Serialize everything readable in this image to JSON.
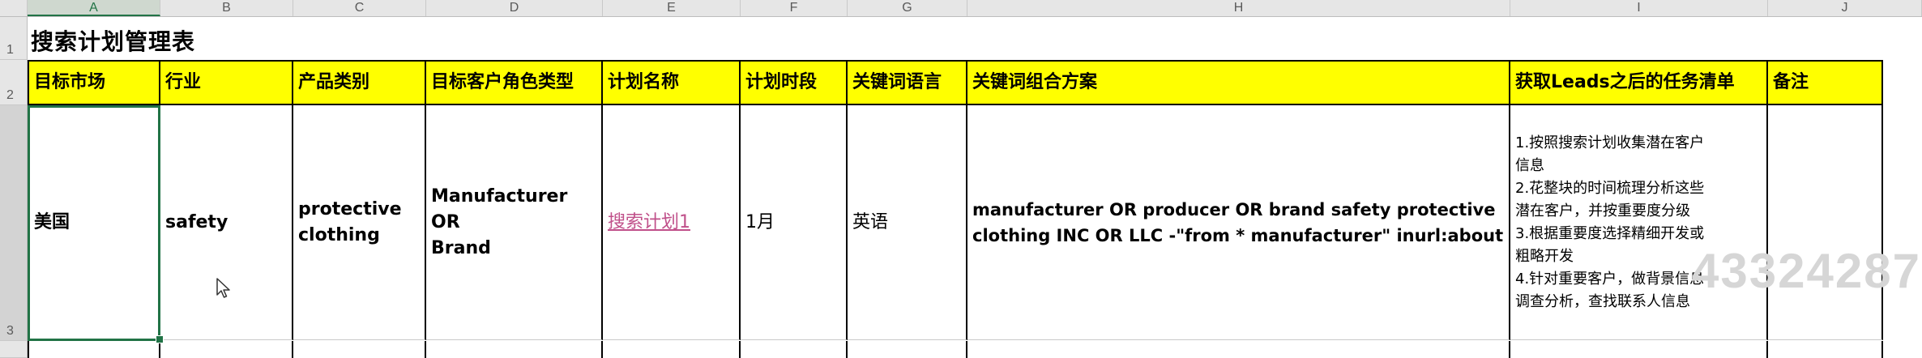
{
  "columns": [
    "A",
    "B",
    "C",
    "D",
    "E",
    "F",
    "G",
    "H",
    "I",
    "J"
  ],
  "rows": [
    "1",
    "2",
    "3"
  ],
  "sheet_title": "搜索计划管理表",
  "headers": [
    "目标市场",
    "行业",
    "产品类别",
    "目标客户角色类型",
    "计划名称",
    "计划时段",
    "关键词语言",
    "关键词组合方案",
    "获取Leads之后的任务清单",
    "备注"
  ],
  "row3": {
    "market": "美国",
    "industry": "safety",
    "product_line1": "protective",
    "product_line2": "clothing",
    "role_line1": "Manufacturer OR",
    "role_line2": "Brand",
    "plan_name": "搜索计划1",
    "period": "1月",
    "language": "英语",
    "keywords_line1": "manufacturer OR producer OR brand safety protective",
    "keywords_line2": "clothing INC OR LLC -\"from * manufacturer\" inurl:about",
    "tasks": [
      "1.按照搜索计划收集潜在客户",
      "信息",
      "2.花整块的时间梳理分析这些",
      "潜在客户，并按重要度分级",
      "3.根据重要度选择精细开发或",
      "粗略开发",
      "4.针对重要客户，做背景信息",
      "调查分析，查找联系人信息"
    ],
    "notes": ""
  },
  "watermark": "43324287",
  "colors": {
    "header_fill": "#ffff00",
    "link": "#c0508a",
    "selection": "#217346"
  }
}
